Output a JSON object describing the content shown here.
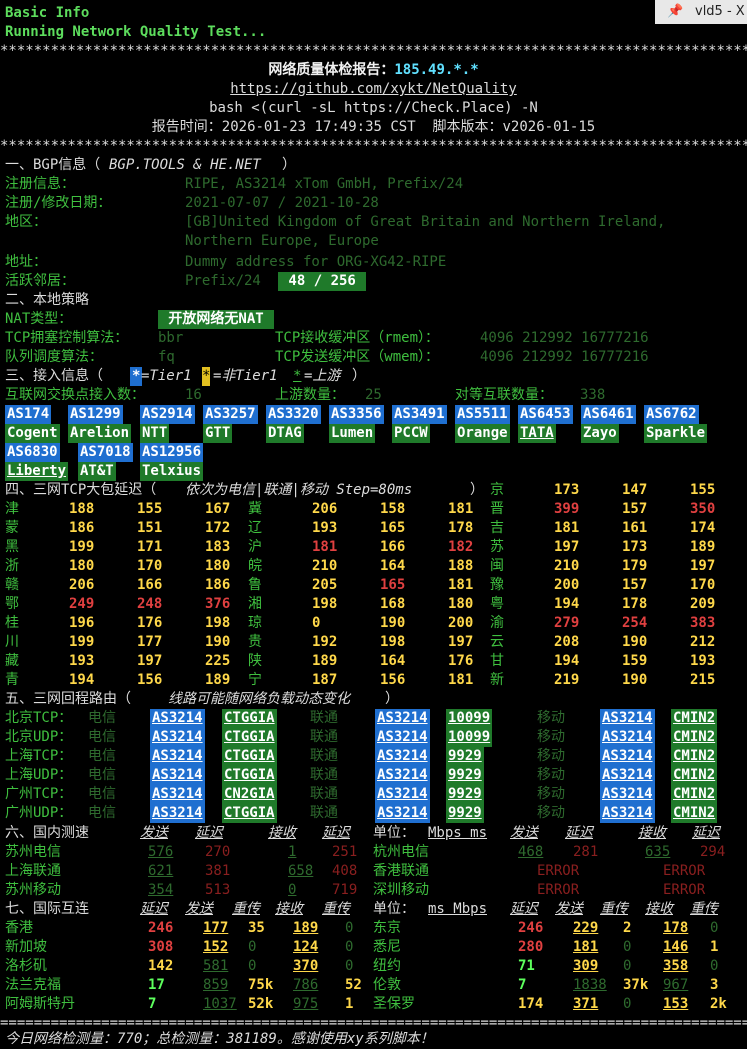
{
  "window": {
    "tab_title": "vld5 - X",
    "pin_glyph": "📌"
  },
  "lines": {
    "basic": "Basic Info",
    "running": "Running Network Quality Test...",
    "stars": "*****************************************************************************************",
    "report_prefix": "网络质量体检报告：",
    "report_ip": "185.49.*.*",
    "repo": "https://github.com/xykt/NetQuality",
    "cmd": "bash <(curl -sL https://Check.Place) -N",
    "time": "报告时间：2026-01-23 17:49:35 CST  脚本版本：v2026-01-15",
    "equals": "===========================================================================================",
    "footer": "今日网络检测量：770；总检测量：381189。感谢使用xy系列脚本！"
  },
  "bgp": {
    "title": "一、BGP信息（",
    "title_i": "BGP.TOOLS & HE.NET",
    "title_end": "）",
    "reg_l": "注册信息：",
    "reg_v": "RIPE, AS3214 xTom GmbH, Prefix/24",
    "date_l": "注册/修改日期：",
    "date_v": "2021-07-07 / 2021-10-28",
    "area_l": "地区：",
    "area_v1": "[GB]United Kingdom of Great Britain and Northern Ireland,",
    "area_v2": "Northern Europe, Europe",
    "addr_l": "地址：",
    "addr_v": "Dummy address for ORG-XG42-RIPE",
    "nb_l": "活跃邻居：",
    "nb_v": "Prefix/24",
    "nb_box": " 48 / 256 "
  },
  "policy": {
    "title": "二、本地策略",
    "nat_l": "NAT类型：",
    "nat_v": " 开放网络无NAT ",
    "tcp_l": "TCP拥塞控制算法：",
    "tcp_v": "bbr",
    "rmem_l": "TCP接收缓冲区（rmem）：",
    "rmem_v": "4096 212992 16777216",
    "q_l": "队列调度算法：",
    "q_v": "fq",
    "wmem_l": "TCP发送缓冲区（wmem）：",
    "wmem_v": "4096 212992 16777216"
  },
  "access": {
    "title": "三、接入信息（",
    "t1": "*",
    "t1d": "=Tier1 ",
    "t2": "*",
    "t2d": "=非Tier1 ",
    "t3": "*",
    "t3d": "=上游",
    "tend": "）",
    "ix_l": "互联网交换点接入数：",
    "ix_v": "16",
    "up_l": "上游数量：",
    "up_v": "25",
    "peer_l": "对等互联数量：",
    "peer_v": "338",
    "as1": [
      "AS174",
      "AS1299",
      "AS2914",
      "AS3257",
      "AS3320",
      "AS3356",
      "AS3491",
      "AS5511",
      "AS6453",
      "AS6461",
      "AS6762"
    ],
    "nm1": [
      "Cogent",
      "Arelion",
      "NTT",
      "GTT",
      "DTAG",
      "Lumen",
      "PCCW",
      "Orange",
      "TATA",
      "Zayo",
      "Sparkle"
    ],
    "as2": [
      "AS6830",
      "AS7018",
      "AS12956"
    ],
    "nm2": [
      "Liberty",
      "AT&T",
      "Telxius"
    ]
  },
  "tcp": {
    "title": "四、三网TCP大包延迟（",
    "title_i": "依次为电信|联通|移动 Step=80ms",
    "title_end": "）",
    "rows": [
      [
        [
          "",
          "",
          "",
          ""
        ],
        [
          "",
          "",
          "",
          ""
        ],
        [
          "京",
          "173",
          "147",
          "155"
        ]
      ],
      [
        [
          "津",
          "188",
          "155",
          "167"
        ],
        [
          "冀",
          "206",
          "158",
          "181"
        ],
        [
          "晋",
          "399",
          "157",
          "350"
        ]
      ],
      [
        [
          "蒙",
          "186",
          "151",
          "172"
        ],
        [
          "辽",
          "193",
          "165",
          "178"
        ],
        [
          "吉",
          "181",
          "161",
          "174"
        ]
      ],
      [
        [
          "黑",
          "199",
          "171",
          "183"
        ],
        [
          "沪",
          "181",
          "166",
          "182"
        ],
        [
          "苏",
          "197",
          "173",
          "189"
        ]
      ],
      [
        [
          "浙",
          "180",
          "170",
          "180"
        ],
        [
          "皖",
          "210",
          "164",
          "188"
        ],
        [
          "闽",
          "210",
          "179",
          "197"
        ]
      ],
      [
        [
          "赣",
          "206",
          "166",
          "186"
        ],
        [
          "鲁",
          "205",
          "165",
          "181"
        ],
        [
          "豫",
          "200",
          "157",
          "170"
        ]
      ],
      [
        [
          "鄂",
          "249",
          "248",
          "376"
        ],
        [
          "湘",
          "198",
          "168",
          "180"
        ],
        [
          "粤",
          "194",
          "178",
          "209"
        ]
      ],
      [
        [
          "桂",
          "196",
          "176",
          "198"
        ],
        [
          "琼",
          "0",
          "190",
          "200"
        ],
        [
          "渝",
          "279",
          "254",
          "383"
        ]
      ],
      [
        [
          "川",
          "199",
          "177",
          "190"
        ],
        [
          "贵",
          "192",
          "198",
          "197"
        ],
        [
          "云",
          "208",
          "190",
          "212"
        ]
      ],
      [
        [
          "藏",
          "193",
          "197",
          "225"
        ],
        [
          "陕",
          "189",
          "164",
          "176"
        ],
        [
          "甘",
          "194",
          "159",
          "193"
        ]
      ],
      [
        [
          "青",
          "194",
          "156",
          "189"
        ],
        [
          "宁",
          "187",
          "156",
          "181"
        ],
        [
          "新",
          "219",
          "190",
          "215"
        ]
      ]
    ]
  },
  "route": {
    "title": "五、三网回程路由（",
    "title_i": "线路可能随网络负载动态变化",
    "title_end": "）",
    "isp": [
      "电信",
      "联通",
      "移动"
    ],
    "rows": [
      {
        "label": "北京TCP：",
        "ct": [
          "AS3214",
          "CTGGIA"
        ],
        "cu": [
          "AS3214",
          "10099"
        ],
        "cm": [
          "AS3214",
          "CMIN2"
        ]
      },
      {
        "label": "北京UDP：",
        "ct": [
          "AS3214",
          "CTGGIA"
        ],
        "cu": [
          "AS3214",
          "10099"
        ],
        "cm": [
          "AS3214",
          "CMIN2"
        ]
      },
      {
        "label": "上海TCP：",
        "ct": [
          "AS3214",
          "CTGGIA"
        ],
        "cu": [
          "AS3214",
          "9929"
        ],
        "cm": [
          "AS3214",
          "CMIN2"
        ]
      },
      {
        "label": "上海UDP：",
        "ct": [
          "AS3214",
          "CTGGIA"
        ],
        "cu": [
          "AS3214",
          "9929"
        ],
        "cm": [
          "AS3214",
          "CMIN2"
        ]
      },
      {
        "label": "广州TCP：",
        "ct": [
          "AS3214",
          "CN2GIA"
        ],
        "cu": [
          "AS3214",
          "9929"
        ],
        "cm": [
          "AS3214",
          "CMIN2"
        ]
      },
      {
        "label": "广州UDP：",
        "ct": [
          "AS3214",
          "CTGGIA"
        ],
        "cu": [
          "AS3214",
          "9929"
        ],
        "cm": [
          "AS3214",
          "CMIN2"
        ]
      }
    ]
  },
  "domestic": {
    "title": "六、国内测速",
    "h": [
      "发送",
      "延迟",
      "接收",
      "延迟"
    ],
    "unit_l": "单位：",
    "unit_v": "Mbps ms",
    "rows": [
      {
        "l": [
          "苏州电信",
          "576",
          "270",
          "1",
          "251"
        ],
        "r": [
          "杭州电信",
          "468",
          "281",
          "635",
          "294"
        ]
      },
      {
        "l": [
          "上海联通",
          "621",
          "381",
          "658",
          "408"
        ],
        "r": [
          "香港联通",
          "ERROR",
          "",
          "ERROR",
          ""
        ]
      },
      {
        "l": [
          "苏州移动",
          "354",
          "513",
          "0",
          "719"
        ],
        "r": [
          "深圳移动",
          "ERROR",
          "",
          "ERROR",
          ""
        ]
      }
    ]
  },
  "intl": {
    "title": "七、国际互连",
    "h": [
      "延迟",
      "发送",
      "重传",
      "接收",
      "重传"
    ],
    "unit_l": "单位：",
    "unit_v": "ms Mbps",
    "rows": [
      {
        "l": [
          "香港",
          "246",
          "177",
          "35",
          "189",
          "0"
        ],
        "r": [
          "东京",
          "246",
          "229",
          "2",
          "178",
          "0"
        ]
      },
      {
        "l": [
          "新加坡",
          "308",
          "152",
          "0",
          "124",
          "0"
        ],
        "r": [
          "悉尼",
          "280",
          "181",
          "0",
          "146",
          "1"
        ]
      },
      {
        "l": [
          "洛杉矶",
          "142",
          "581",
          "0",
          "370",
          "0"
        ],
        "r": [
          "纽约",
          "71",
          "309",
          "0",
          "358",
          "0"
        ]
      },
      {
        "l": [
          "法兰克福",
          "17",
          "859",
          "75k",
          "786",
          "52"
        ],
        "r": [
          "伦敦",
          "7",
          "1838",
          "37k",
          "967",
          "3"
        ]
      },
      {
        "l": [
          "阿姆斯特丹",
          "7",
          "1037",
          "52k",
          "975",
          "1"
        ],
        "r": [
          "圣保罗",
          "174",
          "371",
          "0",
          "153",
          "2k"
        ]
      }
    ]
  }
}
